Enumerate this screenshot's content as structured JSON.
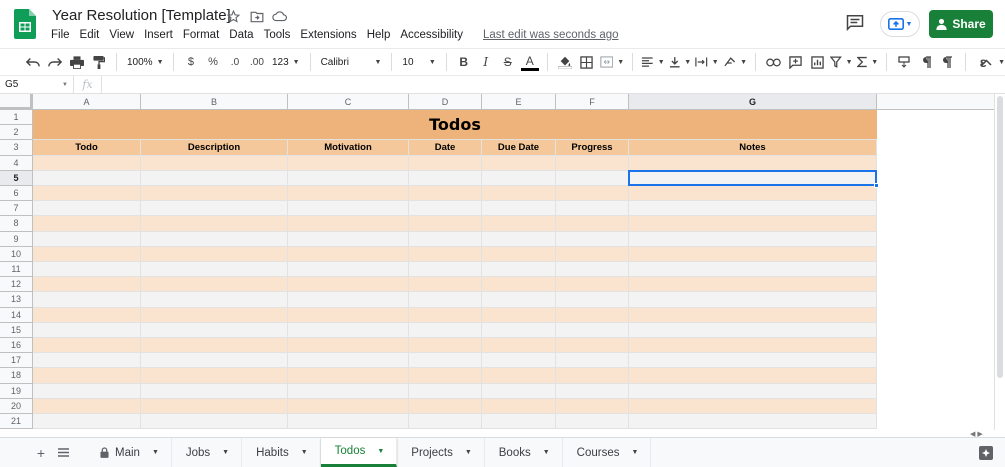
{
  "app": {
    "title": "Year Resolution [Template]",
    "menu": [
      "File",
      "Edit",
      "View",
      "Insert",
      "Format",
      "Data",
      "Tools",
      "Extensions",
      "Help",
      "Accessibility"
    ],
    "last_edit": "Last edit was seconds ago",
    "share_label": "Share"
  },
  "toolbar": {
    "zoom": "100%",
    "currency": "$",
    "percent": "%",
    "dec_decrease": ".0",
    "dec_increase": ".00",
    "more_formats": "123",
    "font": "Calibri",
    "font_size": "10",
    "bold": "B",
    "italic": "I",
    "strike": "S",
    "text_color": "A",
    "input_tools": "ε"
  },
  "formula_bar": {
    "name_box": "G5",
    "fx": "fx",
    "value": ""
  },
  "grid": {
    "columns": [
      "A",
      "B",
      "C",
      "D",
      "E",
      "F",
      "G"
    ],
    "selected_column": "G",
    "rows": [
      "1",
      "2",
      "3",
      "4",
      "5",
      "6",
      "7",
      "8",
      "9",
      "10",
      "11",
      "12",
      "13",
      "14",
      "15",
      "16",
      "17",
      "18",
      "19",
      "20",
      "21"
    ],
    "selected_row": "5",
    "title": "Todos",
    "headers": [
      "Todo",
      "Description",
      "Motivation",
      "Date",
      "Due Date",
      "Progress",
      "Notes"
    ],
    "selected_cell": "G5"
  },
  "sheets": {
    "tabs": [
      "Main",
      "Jobs",
      "Habits",
      "Todos",
      "Projects",
      "Books",
      "Courses"
    ],
    "active": "Todos",
    "locked": [
      "Main"
    ]
  },
  "colors": {
    "title_band": "#eeb37b",
    "header_band": "#f4c89a",
    "odd_row": "#f3f3f3",
    "even_row": "#fae4cf",
    "share": "#188038",
    "selection": "#1a73e8"
  }
}
